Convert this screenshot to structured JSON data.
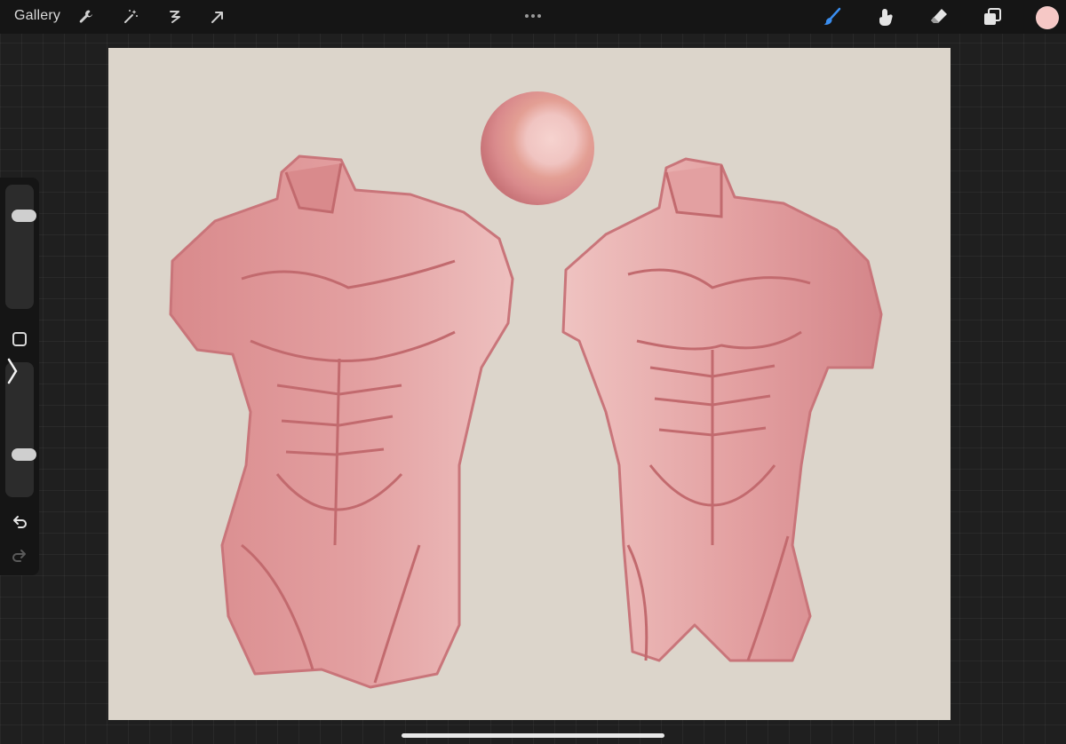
{
  "topbar": {
    "gallery_label": "Gallery",
    "left_tools": [
      "wrench-icon",
      "magic-wand-icon",
      "selection-icon",
      "transform-arrow-icon"
    ],
    "right_tools": [
      "brush-icon",
      "smudge-icon",
      "eraser-icon",
      "layers-icon"
    ],
    "active_tool": "brush",
    "current_color": "#f6c8c6"
  },
  "canvas": {
    "background": "#dcd5cb",
    "paint_color": "#d98a8c",
    "line_color": "#c26a6e"
  },
  "sidebar": {
    "brush_size_level": 0.78,
    "opacity_level": 0.3,
    "buttons": [
      "modify-square-icon",
      "expand-chevron-icon",
      "undo-icon",
      "redo-icon"
    ]
  }
}
